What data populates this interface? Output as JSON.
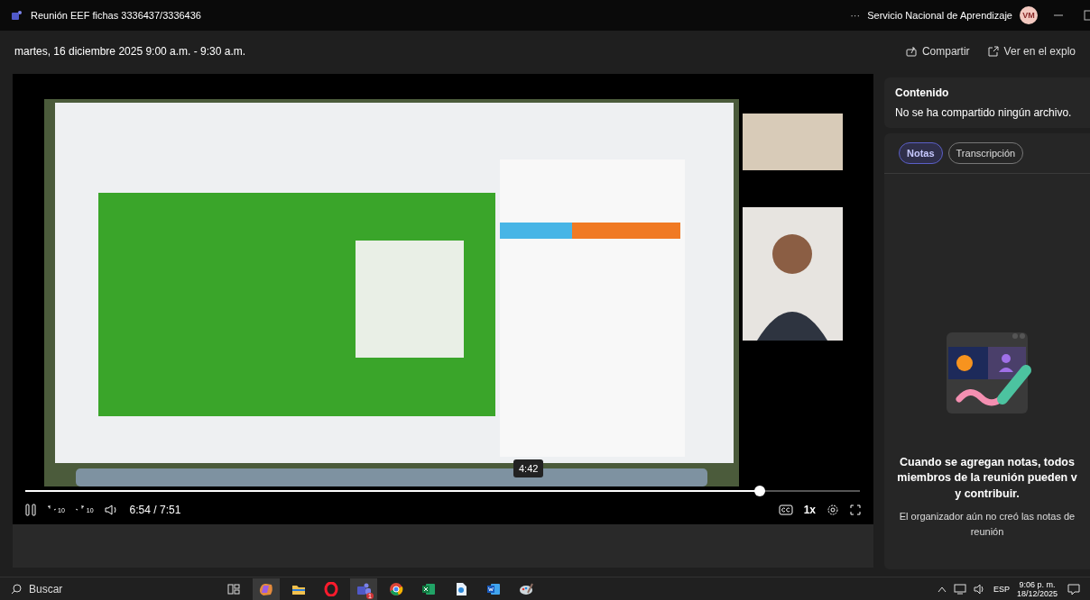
{
  "window": {
    "title": "Reunión EEF fichas 3336437/3336436",
    "more": "···",
    "organization": "Servicio Nacional de Aprendizaje",
    "avatar": "VM"
  },
  "header": {
    "date": "martes, 16 diciembre 2025 9:00 a.m. - 9:30 a.m.",
    "actions": [
      {
        "label": "Compartir",
        "kind": "share"
      },
      {
        "label": "Ver en el explo",
        "kind": "open"
      }
    ]
  },
  "player": {
    "seek_tooltip": "4:42",
    "level": 0.88,
    "rewind": "10",
    "forward": "10",
    "time": "6:54 / 7:51",
    "speed": "1x"
  },
  "content": {
    "title": "Contenido",
    "message": "No se ha compartido ningún archivo."
  },
  "notes": {
    "tabs": [
      {
        "label": "Notas",
        "selected": true
      },
      {
        "label": "Transcripción",
        "selected": false
      }
    ],
    "heading_lines": [
      "Cuando se agregan notas, todos",
      "miembros de la reunión pueden v",
      "y contribuir."
    ],
    "message_lines": [
      "El organizador aún no creó las notas de",
      "reunión"
    ]
  },
  "taskbar": {
    "search": "Buscar",
    "apps": [
      {
        "kind": "taskview"
      },
      {
        "kind": "copilot"
      },
      {
        "kind": "folder"
      },
      {
        "kind": "opera"
      },
      {
        "kind": "teams",
        "badge": "1"
      },
      {
        "kind": "chrome"
      },
      {
        "kind": "excel"
      },
      {
        "kind": "document"
      },
      {
        "kind": "word"
      },
      {
        "kind": "paint"
      }
    ],
    "language": "ESP",
    "time": "9:06 p. m.",
    "date": "18/12/2025"
  }
}
